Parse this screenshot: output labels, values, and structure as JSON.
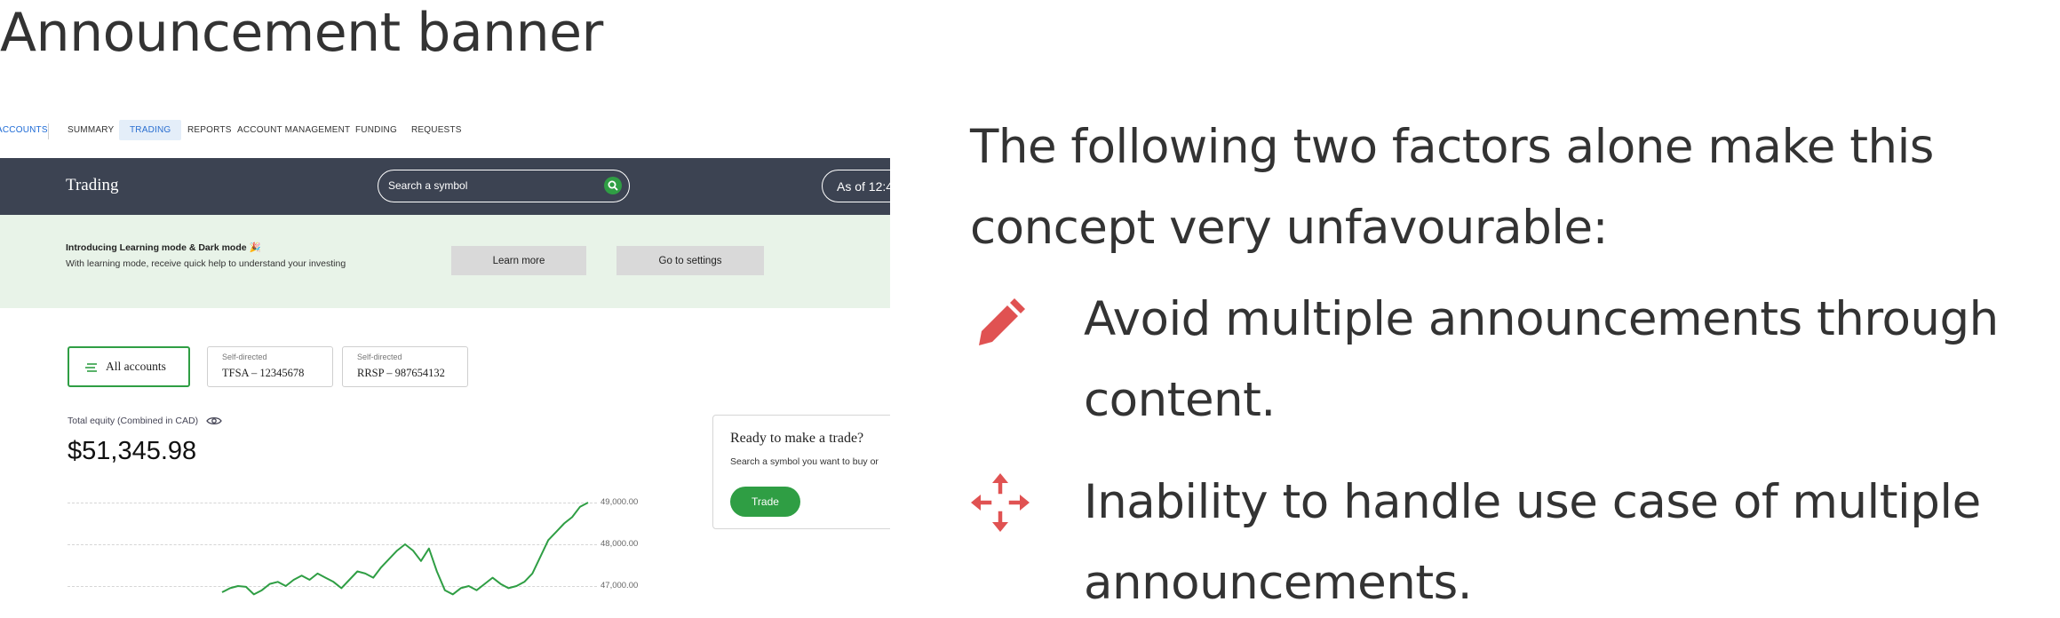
{
  "slide": {
    "title": "Announcement banner",
    "intro": "The following two factors alone make this concept very unfavourable:",
    "bullets": [
      {
        "icon": "pencil-icon",
        "text": "Avoid multiple announcements through content."
      },
      {
        "icon": "move-arrows-icon",
        "text": "Inability to handle use case of multiple announcements."
      }
    ],
    "accent_color": "#e05252"
  },
  "app": {
    "nav": {
      "items": [
        "ACCOUNTS",
        "SUMMARY",
        "TRADING",
        "REPORTS",
        "ACCOUNT MANAGEMENT",
        "FUNDING",
        "REQUESTS"
      ],
      "active": "TRADING"
    },
    "header": {
      "title": "Trading",
      "search_placeholder": "Search a symbol",
      "as_of": "As of 12:4"
    },
    "banner": {
      "title": "Introducing Learning mode & Dark mode 🎉",
      "subtitle": "With learning mode, receive quick help to understand your investing",
      "learn_more": "Learn more",
      "go_settings": "Go to settings"
    },
    "accounts": {
      "all_label": "All accounts",
      "tfsa_type": "Self-directed",
      "tfsa_number": "TFSA – 12345678",
      "rrsp_type": "Self-directed",
      "rrsp_number": "RRSP – 987654132"
    },
    "equity": {
      "label": "Total equity (Combined in CAD)",
      "value": "$51,345.98"
    },
    "trade_card": {
      "title": "Ready to make a trade?",
      "subtitle": "Search a symbol you want to buy or",
      "button": "Trade"
    },
    "colors": {
      "topbar": "#3c4352",
      "banner_bg": "#e8f3e8",
      "brand_green": "#2f9e44",
      "active_tab_bg": "#e4eef9"
    }
  },
  "chart_data": {
    "type": "line",
    "y_ticks": [
      "49,000.00",
      "48,000.00",
      "47,000.00"
    ],
    "ylim": [
      46800,
      49200
    ],
    "series": [
      {
        "values": [
          46850,
          46950,
          47000,
          46980,
          46800,
          46900,
          47050,
          47100,
          47000,
          47150,
          47250,
          47150,
          47300,
          47200,
          47100,
          46950,
          47150,
          47350,
          47300,
          47200,
          47450,
          47650,
          47850,
          48000,
          47850,
          47600,
          47900,
          47350,
          46900,
          46800,
          46950,
          47000,
          46900,
          47050,
          47200,
          47050,
          46950,
          47000,
          47100,
          47300,
          47700,
          48100,
          48300,
          48500,
          48650,
          48900,
          49000
        ]
      }
    ]
  }
}
